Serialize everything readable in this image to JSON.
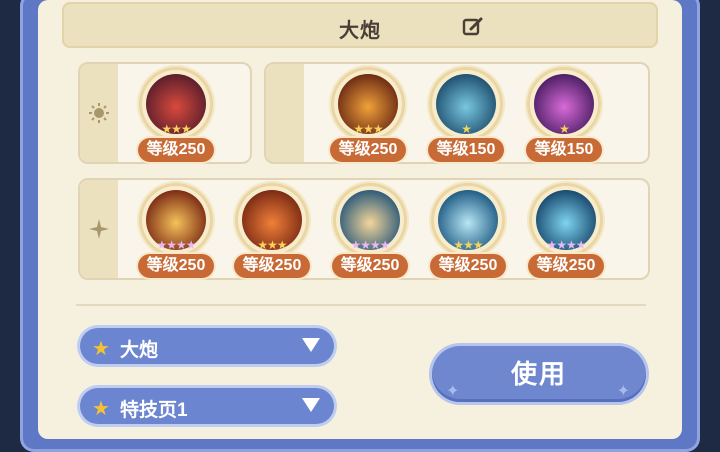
{
  "title": "大炮",
  "groups": {
    "sun": {
      "icon": "sun-icon",
      "skills": [
        {
          "level": "等级250",
          "stars": "★★★",
          "art_colors": [
            "#5a1e2c",
            "#d94a3c"
          ],
          "icon": "dark-orb-icon"
        }
      ]
    },
    "moon": {
      "icon": "crescent-moon-icon",
      "skills": [
        {
          "level": "等级250",
          "stars": "★★★",
          "art_colors": [
            "#6b2a14",
            "#f0a13a"
          ],
          "icon": "fire-burst-icon"
        },
        {
          "level": "等级150",
          "stars": "★",
          "art_colors": [
            "#1e4f6e",
            "#7ac7e0"
          ],
          "icon": "tide-icon"
        },
        {
          "level": "等级150",
          "stars": "★",
          "art_colors": [
            "#4b1e64",
            "#d86bd8"
          ],
          "icon": "crosshair-icon"
        }
      ]
    },
    "spark": {
      "icon": "sparkle-icon",
      "skills": [
        {
          "level": "等级250",
          "stars": "★★★★",
          "art_colors": [
            "#7a2a14",
            "#f6c25a"
          ],
          "icon": "explosion-icon"
        },
        {
          "level": "等级250",
          "stars": "★★★",
          "art_colors": [
            "#7a2a14",
            "#f0803a"
          ],
          "icon": "vortex-icon"
        },
        {
          "level": "等级250",
          "stars": "★★★★",
          "art_colors": [
            "#2c5a7a",
            "#f4d69a"
          ],
          "icon": "crystal-icon"
        },
        {
          "level": "等级250",
          "stars": "★★★",
          "art_colors": [
            "#1e5b84",
            "#b8e6f4"
          ],
          "icon": "ice-slash-icon"
        },
        {
          "level": "等级250",
          "stars": "★★★★",
          "art_colors": [
            "#18486e",
            "#7fd4ef"
          ],
          "icon": "ice-shard-icon"
        }
      ]
    }
  },
  "selects": {
    "weapon": "大炮",
    "page": "特技页1"
  },
  "use_button": "使用",
  "colors": {
    "accent": "#6c85d0",
    "level_badge": "#c76a36",
    "panel": "#f6f0df"
  }
}
